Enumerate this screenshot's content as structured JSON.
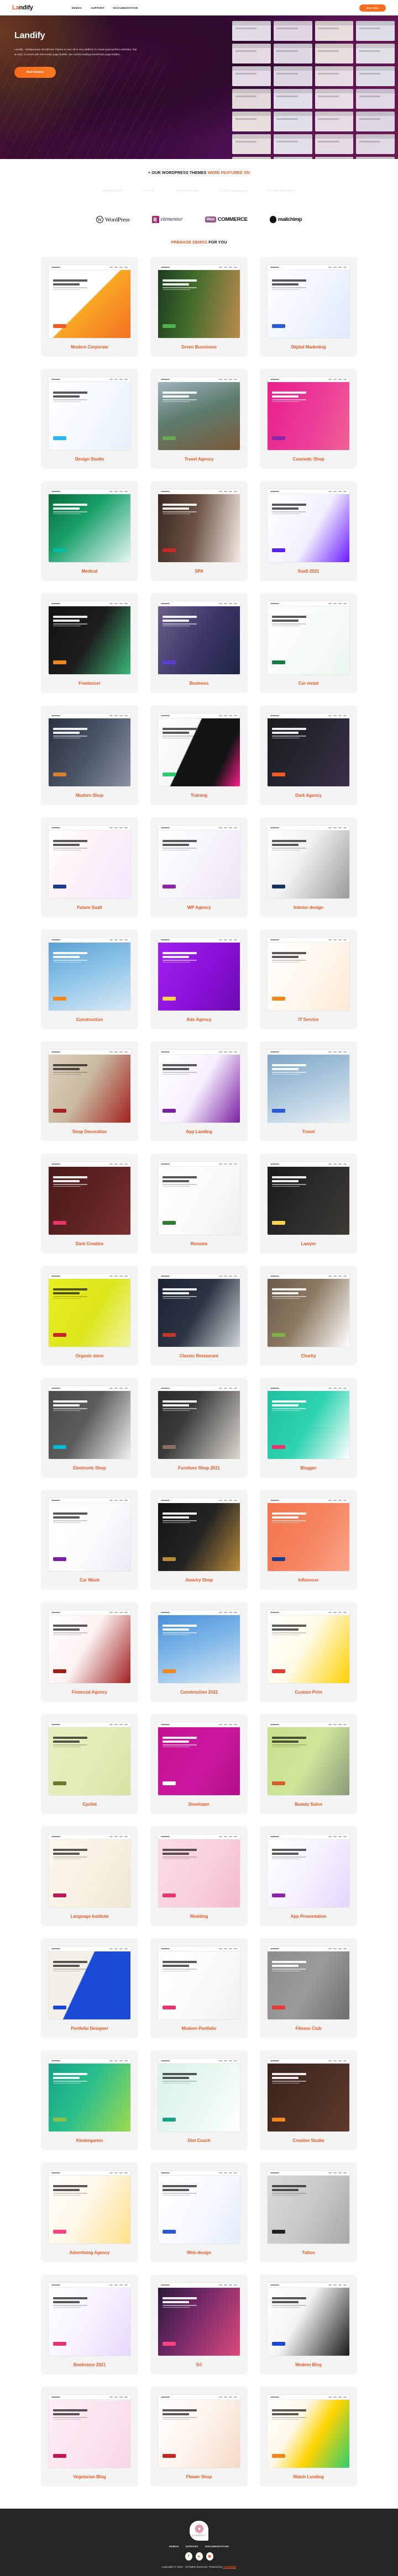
{
  "header": {
    "brand_prefix": "La",
    "brand_suffix": "ndify",
    "nav": [
      {
        "label": "DEMOS",
        "name": "nav-demos"
      },
      {
        "label": "SUPPORT",
        "name": "nav-support"
      },
      {
        "label": "DOCUMENTATION",
        "name": "nav-documentation"
      }
    ],
    "buy_label": "Buy Now"
  },
  "hero": {
    "title": "Landify",
    "description": "Landify - Multipurpose WordPress Theme is your all-in-one platform to create pixel-perfect websites, fast & easy. It comes with Elementor page builder, the world's leading WordPress page builder.",
    "cta_label": "Main Demos"
  },
  "featured": {
    "title_plain": "+ OUR WORDPRESS THEMES ",
    "title_accent": "WERE FEATURED ON",
    "press_logos": [
      {
        "label": "AWWWARDS",
        "name": "logo-awwwards"
      },
      {
        "label": "colorlib.",
        "name": "logo-colorlib"
      },
      {
        "label": "inspirationfeed",
        "name": "logo-inspirationfeed"
      },
      {
        "label": "CSSDesignAwards",
        "name": "logo-cssdesignawards"
      },
      {
        "label": "Design Nominees",
        "name": "logo-design-nominees"
      }
    ],
    "brand_logos": [
      {
        "label": "WordPress",
        "name": "logo-wordpress"
      },
      {
        "label": "elementor",
        "name": "logo-elementor"
      },
      {
        "label": "COMMERCE",
        "mark": "Woo",
        "name": "logo-woocommerce"
      },
      {
        "label": "mailchimp",
        "name": "logo-mailchimp"
      }
    ]
  },
  "demos": {
    "title_accent": "PREMADE DEMOS",
    "title_plain": " FOR YOU",
    "items": [
      {
        "label": "Modern Corporate",
        "hero": "linear-gradient(135deg,#ffffff 0%,#ffffff 48%,#f9a825 48%,#f37021 100%)",
        "text": "dark",
        "btn": "#f15a24"
      },
      {
        "label": "Green Bussiness",
        "hero": "linear-gradient(100deg,#1d3b20 0%,#3f6b2a 40%,#b98a4e 100%)",
        "text": "light",
        "btn": "#4caf50"
      },
      {
        "label": "Digital Marketing",
        "hero": "linear-gradient(120deg,#ffffff 0%,#eef3ff 60%,#dfe8ff 100%)",
        "text": "dark",
        "btn": "#2b5bd7"
      },
      {
        "label": "Design Studio",
        "hero": "linear-gradient(120deg,#ffffff 0%,#f4f8ff 55%,#e6f0fb 100%)",
        "text": "dark",
        "btn": "#29b6f6"
      },
      {
        "label": "Travel Agency",
        "hero": "linear-gradient(160deg,#9fb3bd 0%,#5d7c6e 45%,#7a5a3a 100%)",
        "text": "light",
        "btn": "#6aa84f"
      },
      {
        "label": "Cosmetic Shop",
        "hero": "linear-gradient(110deg,#e91e8c 0%,#ec3f99 60%,#f06292 100%)",
        "text": "light",
        "btn": "#8e24aa"
      },
      {
        "label": "Medical",
        "hero": "linear-gradient(135deg,#0b6b3a 0%,#19a06a 40%,#e8f7f4 100%)",
        "text": "light",
        "btn": "#00bfa5"
      },
      {
        "label": "SPA",
        "hero": "linear-gradient(100deg,#3c2a22 0%,#6b5245 45%,#f3eae2 100%)",
        "text": "light",
        "btn": "#c62828"
      },
      {
        "label": "SaaS 2021",
        "hero": "linear-gradient(120deg,#ffffff 0%,#f2f0ff 55%,#6a1bff 100%)",
        "text": "dark",
        "btn": "#5b21f0"
      },
      {
        "label": "Freelancer",
        "hero": "linear-gradient(120deg,#131313 0%,#1d1d1d 50%,#3bb776 100%)",
        "text": "light",
        "btn": "#f0871a"
      },
      {
        "label": "Business",
        "hero": "linear-gradient(120deg,#6b5f8a 0%,#3a3565 55%,#1f2545 100%)",
        "text": "light",
        "btn": "#5b3fd4"
      },
      {
        "label": "Car rental",
        "hero": "linear-gradient(120deg,#ffffff 0%,#f6fbf7 55%,#eef7f0 100%)",
        "text": "dark",
        "btn": "#1b7a43"
      },
      {
        "label": "Modern Shop",
        "hero": "linear-gradient(120deg,#2b3240 0%,#4a5568 50%,#8b93a5 100%)",
        "text": "light",
        "btn": "#d9822b"
      },
      {
        "label": "Training",
        "hero": "linear-gradient(115deg,#ffffff 0%,#f6f6f6 38%,#141414 39%,#141414 75%,#ff1e8e 100%)",
        "text": "dark",
        "btn": "#2ecc71"
      },
      {
        "label": "Dark Agency",
        "hero": "linear-gradient(120deg,#1b1b1f 0%,#262630 50%,#3b2f4a 100%)",
        "text": "light",
        "btn": "#f15a24"
      },
      {
        "label": "Future SaaS",
        "hero": "linear-gradient(120deg,#ffffff 0%,#fdf1f7 45%,#f3e8ff 100%)",
        "text": "dark",
        "btn": "#1a3d8f"
      },
      {
        "label": "WP Agency",
        "hero": "linear-gradient(120deg,#ffffff 0%,#f7f3fb 50%,#ece4f4 100%)",
        "text": "dark",
        "btn": "#8e24aa"
      },
      {
        "label": "Interior design",
        "hero": "linear-gradient(120deg,#ffffff 0%,#f2f2f2 40%,#9a9a9a 100%)",
        "text": "dark",
        "btn": "#16345c"
      },
      {
        "label": "Construction",
        "hero": "linear-gradient(160deg,#5a9fd4 0%,#8cc4e8 45%,#d9e8f3 100%)",
        "text": "light",
        "btn": "#f0871a"
      },
      {
        "label": "Ads Agency",
        "hero": "linear-gradient(120deg,#a020f0 0%,#8b10d8 55%,#6a0bb0 100%)",
        "text": "light",
        "btn": "#ffd54f"
      },
      {
        "label": "IT Service",
        "hero": "linear-gradient(120deg,#ffffff 0%,#fff6ec 55%,#ffe9d4 100%)",
        "text": "dark",
        "btn": "#f0871a"
      },
      {
        "label": "Shop Decoration",
        "hero": "linear-gradient(120deg,#ddd0bd 0%,#c9b99f 45%,#a3221f 100%)",
        "text": "dark",
        "btn": "#a3221f"
      },
      {
        "label": "App Landing",
        "hero": "linear-gradient(120deg,#ffffff 0%,#f7f0ff 50%,#7a1fa2 100%)",
        "text": "dark",
        "btn": "#7a1fa2"
      },
      {
        "label": "Travel",
        "hero": "linear-gradient(160deg,#7ea6c4 0%,#a9c6dc 45%,#e8eff4 100%)",
        "text": "light",
        "btn": "#2b5bd7"
      },
      {
        "label": "Dark Creative",
        "hero": "linear-gradient(120deg,#4a1a1a 0%,#5d2222 50%,#7a3030 100%)",
        "text": "light",
        "btn": "#e8356d"
      },
      {
        "label": "Resume",
        "hero": "linear-gradient(120deg,#ffffff 0%,#fafafa 55%,#efefef 100%)",
        "text": "dark",
        "btn": "#2e7d32"
      },
      {
        "label": "Lawyer",
        "hero": "linear-gradient(120deg,#1a1a1a 0%,#2b2b2b 50%,#3d3a33 100%)",
        "text": "light",
        "btn": "#ffd54f"
      },
      {
        "label": "Organic store",
        "hero": "linear-gradient(120deg,#e8ef21 0%,#dde61d 55%,#f0f4a0 100%)",
        "text": "dark",
        "btn": "#c62828"
      },
      {
        "label": "Classic Restaurant",
        "hero": "linear-gradient(120deg,#1b2332 0%,#2a3442 48%,#cfd4d8 100%)",
        "text": "light",
        "btn": "#c0392b"
      },
      {
        "label": "Charity",
        "hero": "linear-gradient(120deg,#6b5a48 0%,#8c7a62 45%,#ffffff 100%)",
        "text": "light",
        "btn": "#7cb342"
      },
      {
        "label": "Electronic Shop",
        "hero": "linear-gradient(120deg,#4a4a4a 0%,#5c5c5c 45%,#efefef 100%)",
        "text": "light",
        "btn": "#00bcd4"
      },
      {
        "label": "Furniture Shop 2021",
        "hero": "linear-gradient(120deg,#2a2a2a 0%,#3a3a3a 35%,#dcd8d0 100%)",
        "text": "light",
        "btn": "#8d6e63"
      },
      {
        "label": "Blogger",
        "hero": "linear-gradient(120deg,#1fc0a0 0%,#2ed3b0 50%,#ffffff 100%)",
        "text": "light",
        "btn": "#e8356d"
      },
      {
        "label": "Car Wash",
        "hero": "linear-gradient(120deg,#ffffff 0%,#fbfbfd 55%,#eceaf4 100%)",
        "text": "dark",
        "btn": "#7b1fa2"
      },
      {
        "label": "Jewelry Shop",
        "hero": "linear-gradient(120deg,#141414 0%,#242424 50%,#b98a3a 100%)",
        "text": "light",
        "btn": "#b98a3a"
      },
      {
        "label": "Influencer",
        "hero": "linear-gradient(120deg,#f4744c 0%,#f58560 55%,#f9a58a 100%)",
        "text": "light",
        "btn": "#1a3d8f"
      },
      {
        "label": "Financial Agency",
        "hero": "linear-gradient(120deg,#ffffff 0%,#fdf2f2 45%,#a02020 100%)",
        "text": "dark",
        "btn": "#a02020"
      },
      {
        "label": "Construction 2022",
        "hero": "linear-gradient(160deg,#4a90d9 0%,#7db6e8 45%,#d8e8f5 100%)",
        "text": "light",
        "btn": "#f0871a"
      },
      {
        "label": "Custom Print",
        "hero": "linear-gradient(120deg,#ffffff 0%,#fffbe8 45%,#ffd100 100%)",
        "text": "dark",
        "btn": "#e53935"
      },
      {
        "label": "Cyclist",
        "hero": "linear-gradient(120deg,#e7efc0 0%,#e2ebb4 60%,#d7e2a2 100%)",
        "text": "dark",
        "btn": "#6b7a2a"
      },
      {
        "label": "Developer",
        "hero": "linear-gradient(120deg,#c3108f 0%,#cc18a0 55%,#b00f87 100%)",
        "text": "light",
        "btn": "#ffffff"
      },
      {
        "label": "Beauty Salon",
        "hero": "linear-gradient(120deg,#c6e08a 0%,#cfe69b 50%,#8a9a7a 100%)",
        "text": "dark",
        "btn": "#d4622a"
      },
      {
        "label": "Language Institute",
        "hero": "linear-gradient(120deg,#fbf7ec 0%,#f7f1e2 55%,#efe6d2 100%)",
        "text": "dark",
        "btn": "#c2185b"
      },
      {
        "label": "Wedding",
        "hero": "linear-gradient(120deg,#fbdde6 0%,#f8cfdd 55%,#f2b9ce 100%)",
        "text": "dark",
        "btn": "#e8356d"
      },
      {
        "label": "App Presentation",
        "hero": "linear-gradient(120deg,#ffffff 0%,#f6f1ff 50%,#e3d6ff 100%)",
        "text": "dark",
        "btn": "#8e24aa"
      },
      {
        "label": "Portfolio Designer",
        "hero": "linear-gradient(115deg,#f2f0e8 0%,#f2f0e8 40%,#1a49d6 41%,#1a49d6 100%)",
        "text": "dark",
        "btn": "#1a49d6"
      },
      {
        "label": "Modern Portfolio",
        "hero": "linear-gradient(120deg,#ffffff 0%,#fafafa 55%,#f1f1f1 100%)",
        "text": "dark",
        "btn": "#e8356d"
      },
      {
        "label": "Fitness Club",
        "hero": "linear-gradient(120deg,#8c8c8c 0%,#9b9b9b 50%,#6e6e6e 100%)",
        "text": "light",
        "btn": "#e53935"
      },
      {
        "label": "Kindergarten",
        "hero": "linear-gradient(120deg,#17a388 0%,#2bbf8c 45%,#9ed94f 100%)",
        "text": "light",
        "btn": "#8bc34a"
      },
      {
        "label": "Diet Coach",
        "hero": "linear-gradient(120deg,#d9f4ea 0%,#e9f8f1 55%,#ffffff 100%)",
        "text": "dark",
        "btn": "#17a388"
      },
      {
        "label": "Creative Studio",
        "hero": "linear-gradient(120deg,#3a241c 0%,#4a2e22 50%,#5c3a2c 100%)",
        "text": "light",
        "btn": "#f0871a"
      },
      {
        "label": "Advertising Agency",
        "hero": "linear-gradient(120deg,#ffffff 0%,#fff7e8 45%,#ffe08a 100%)",
        "text": "dark",
        "btn": "#ff4081"
      },
      {
        "label": "Web design",
        "hero": "linear-gradient(120deg,#ffffff 0%,#f6f9ff 55%,#e4ecfb 100%)",
        "text": "dark",
        "btn": "#2b5bd7"
      },
      {
        "label": "Tattoo",
        "hero": "linear-gradient(120deg,#d9d9d9 0%,#c9c9c9 50%,#a8a8a8 100%)",
        "text": "dark",
        "btn": "#222222"
      },
      {
        "label": "Bookstore 2021",
        "hero": "linear-gradient(120deg,#ffffff 0%,#f7f2ff 50%,#e6d8fb 100%)",
        "text": "dark",
        "btn": "#e8356d"
      },
      {
        "label": "DJ",
        "hero": "linear-gradient(120deg,#2a1a3a 0%,#7a2a6a 45%,#d94a7a 100%)",
        "text": "light",
        "btn": "#ff4081"
      },
      {
        "label": "Modern Blog",
        "hero": "linear-gradient(120deg,#ffffff 0%,#f4f4f4 40%,#1a1a1a 100%)",
        "text": "dark",
        "btn": "#1a49d6"
      },
      {
        "label": "Vegetarian Blog",
        "hero": "linear-gradient(120deg,#fdeef5 0%,#fbe4ef 55%,#f7d6e6 100%)",
        "text": "dark",
        "btn": "#c2185b"
      },
      {
        "label": "Flower Shop",
        "hero": "linear-gradient(120deg,#ffffff 0%,#fdf3ec 50%,#f5d9c4 100%)",
        "text": "dark",
        "btn": "#c62828"
      },
      {
        "label": "Watch Landing",
        "hero": "linear-gradient(120deg,#ffffff 0%,#fff8e8 35%,#ffd400 60%,#2ecc71 100%)",
        "text": "dark",
        "btn": "#f0871a"
      }
    ]
  },
  "footer": {
    "logo_text": "LANDIFY",
    "nav": [
      {
        "label": "DEMOS",
        "name": "footer-nav-demos"
      },
      {
        "label": "SUPPORT",
        "name": "footer-nav-support"
      },
      {
        "label": "DOCUMENTATION",
        "name": "footer-nav-documentation"
      }
    ],
    "socials": [
      {
        "glyph": "f",
        "name": "facebook-icon"
      },
      {
        "glyph": "❧",
        "name": "twitter-icon"
      },
      {
        "glyph": "✺",
        "name": "dribbble-icon"
      }
    ],
    "copyright_plain": "Copyrights © 2022 . All Rights Reserved. Powered by ",
    "copyright_accent": "Astoundify"
  },
  "colors": {
    "accent": "#f15a24",
    "cta": "#f96e1e",
    "card_bg": "#f4f4f4",
    "footer_bg": "#252525"
  }
}
